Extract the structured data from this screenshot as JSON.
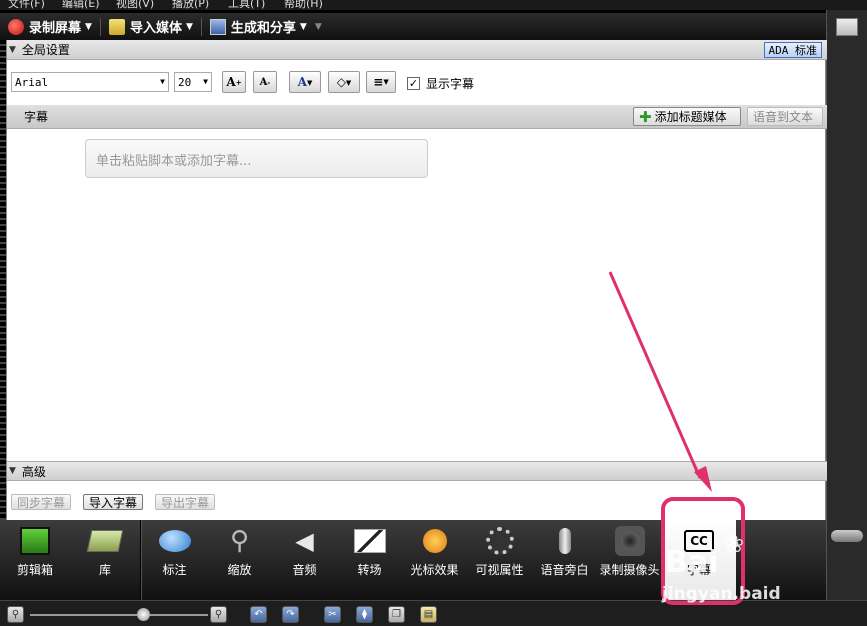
{
  "menubar": {
    "items": [
      "文件(F)",
      "编辑(E)",
      "视图(V)",
      "播放(P)",
      "工具(T)",
      "帮助(H)"
    ]
  },
  "toolbar": {
    "record": "录制屏幕",
    "import": "导入媒体",
    "produce": "生成和分享"
  },
  "global": {
    "title": "全局设置",
    "ada": "ADA 标准",
    "font": "Arial",
    "size": "20",
    "show_captions": "显示字幕"
  },
  "captions": {
    "title": "字幕",
    "add_media": "添加标题媒体",
    "speech_to_text": "语音到文本",
    "placeholder": "单击粘贴脚本或添加字幕..."
  },
  "advanced": {
    "title": "高级",
    "sync": "同步字幕",
    "import": "导入字幕",
    "export": "导出字幕"
  },
  "tools": [
    {
      "label": "剪辑箱",
      "icon": "clip-bin-icon"
    },
    {
      "label": "库",
      "icon": "library-icon"
    },
    {
      "label": "标注",
      "icon": "callout-icon"
    },
    {
      "label": "缩放",
      "icon": "zoom-icon"
    },
    {
      "label": "音频",
      "icon": "audio-icon"
    },
    {
      "label": "转场",
      "icon": "transition-icon"
    },
    {
      "label": "光标效果",
      "icon": "cursor-effects-icon"
    },
    {
      "label": "可视属性",
      "icon": "visual-properties-icon"
    },
    {
      "label": "语音旁白",
      "icon": "voice-narration-icon"
    },
    {
      "label": "录制摄像头",
      "icon": "camera-icon"
    },
    {
      "label": "字幕",
      "icon": "cc-icon"
    }
  ],
  "status": {
    "zoom_slider_level": 0.64
  },
  "watermark": {
    "brand": "Bai",
    "url": "jingyan.baid"
  },
  "colors": {
    "highlight": "#e0306a",
    "accent_blue": "#4a6fb8"
  }
}
